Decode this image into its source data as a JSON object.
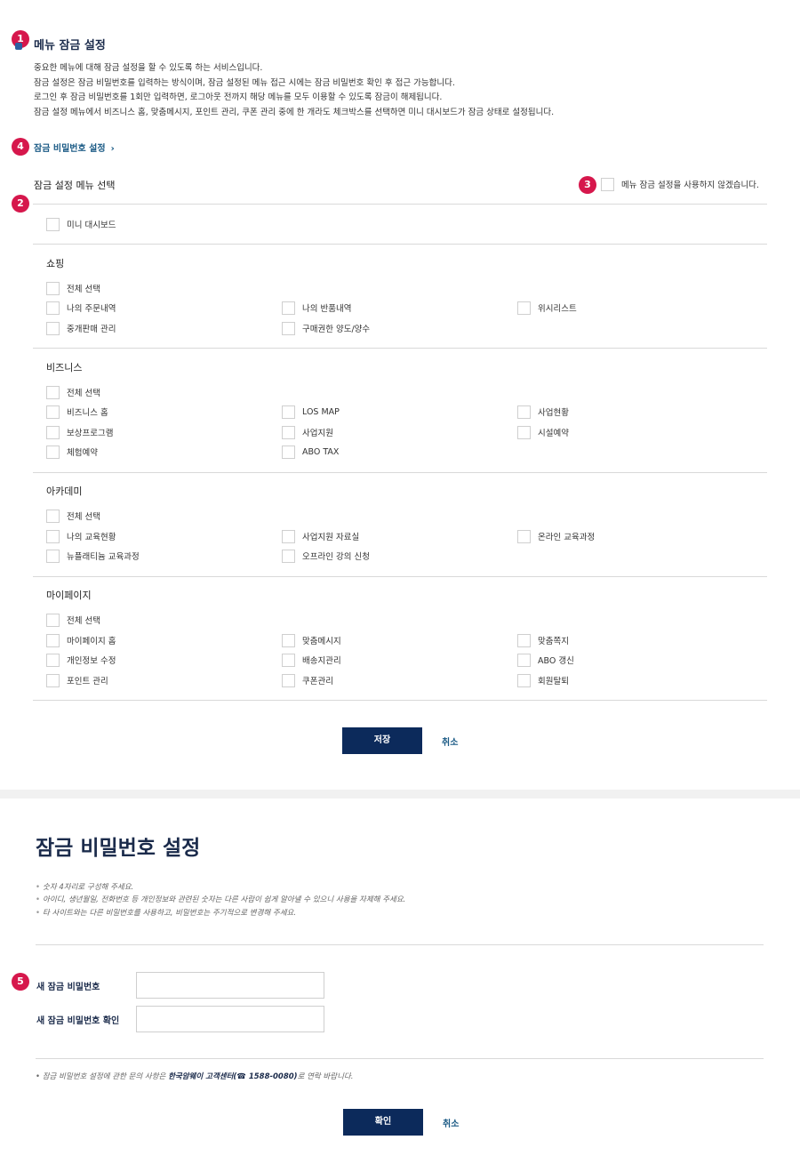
{
  "badges": [
    "1",
    "2",
    "3",
    "4",
    "5"
  ],
  "menu_lock": {
    "title": "메뉴 잠금 설정",
    "description": [
      "중요한 메뉴에 대해 잠금 설정을 할 수 있도록 하는 서비스입니다.",
      "잠금 설정은 잠금 비밀번호를 입력하는 방식이며, 잠금 설정된 메뉴 접근 시에는 잠금 비밀번호 확인 후 접근 가능합니다.",
      "로그인 후 잠금 비밀번호를 1회만 입력하면, 로그아웃 전까지 해당 메뉴를 모두 이용할 수 있도록 잠금이 해제됩니다.",
      "잠금 설정 메뉴에서 비즈니스 홈, 맞춤메시지, 포인트 관리, 쿠폰 관리 중에 한 개라도 체크박스를 선택하면 미니 대시보드가 잠금 상태로 설정됩니다."
    ],
    "password_link": "잠금 비밀번호 설정",
    "chevron_icon": "chevron-right-icon",
    "select_title": "잠금 설정 메뉴 선택",
    "no_use_label": "메뉴 잠금 설정을 사용하지 않겠습니다.",
    "mini_dashboard": "미니 대시보드",
    "categories": [
      {
        "title": "쇼핑",
        "select_all": "전체 선택",
        "rows": [
          [
            "나의 주문내역",
            "나의 반품내역",
            "위시리스트"
          ],
          [
            "중개판매 관리",
            "구매권한 양도/양수"
          ]
        ]
      },
      {
        "title": "비즈니스",
        "select_all": "전체 선택",
        "rows": [
          [
            "비즈니스 홈",
            "LOS MAP",
            "사업현황"
          ],
          [
            "보상프로그램",
            "사업지원",
            "시설예약"
          ],
          [
            "체험예약",
            "ABO TAX"
          ]
        ]
      },
      {
        "title": "아카데미",
        "select_all": "전체 선택",
        "rows": [
          [
            "나의 교육현황",
            "사업지원 자료실",
            "온라인 교육과정"
          ],
          [
            "뉴플래티늄 교육과정",
            "오프라인 강의 신청"
          ]
        ]
      },
      {
        "title": "마이페이지",
        "select_all": "전체 선택",
        "rows": [
          [
            "마이페이지 홈",
            "맞춤메시지",
            "맞춤쪽지"
          ],
          [
            "개인정보 수정",
            "배송지관리",
            "ABO 갱신"
          ],
          [
            "포인트 관리",
            "쿠폰관리",
            "회원탈퇴"
          ]
        ]
      }
    ],
    "save_button": "저장",
    "cancel_button": "취소"
  },
  "password_setup": {
    "title": "잠금 비밀번호 설정",
    "notes": [
      "숫자 4자리로 구성해 주세요.",
      "아이디, 생년월일, 전화번호 등 개인정보와 관련된 숫자는 다른 사람이 쉽게 알아낼 수 있으니 사용을 자제해 주세요.",
      "타 사이트와는 다른 비밀번호를 사용하고, 비밀번호는 주기적으로 변경해 주세요."
    ],
    "new_password_label": "새 잠금 비밀번호",
    "new_password_value": "",
    "confirm_password_label": "새 잠금 비밀번호 확인",
    "confirm_password_value": "",
    "contact_prefix": "잠금 비밀번호 설정에 관한 문의 사항은 ",
    "contact_strong": "한국암웨이 고객센터(☎ 1588-0080)",
    "contact_suffix": "로 연락 바랍니다.",
    "confirm_button": "확인",
    "cancel_button": "취소"
  },
  "colors": {
    "accent_navy": "#0c2a5b",
    "badge_red": "#d6174c",
    "link_blue": "#1a5a85"
  }
}
